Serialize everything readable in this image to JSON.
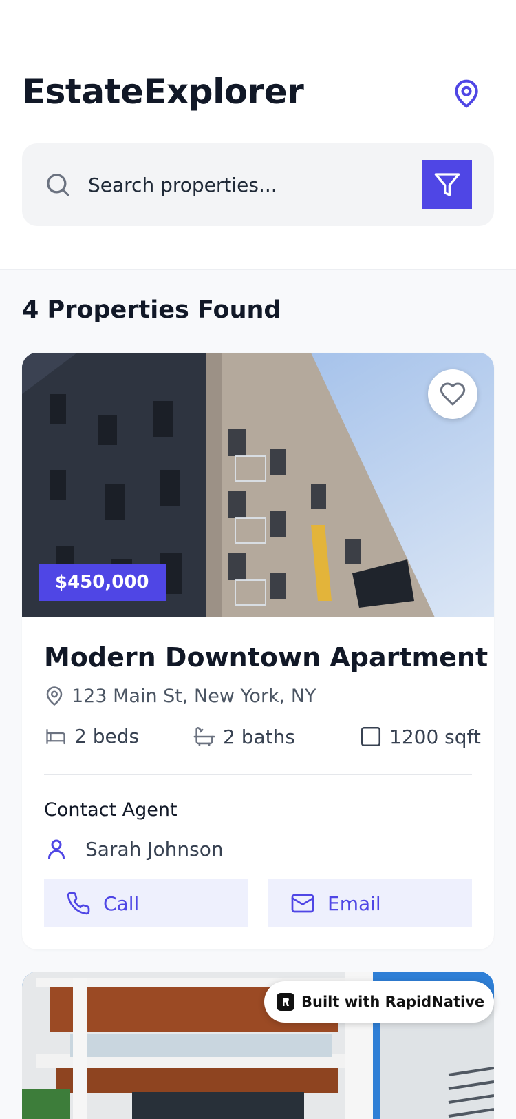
{
  "app": {
    "title": "EstateExplorer"
  },
  "search": {
    "placeholder": "Search properties..."
  },
  "results": {
    "count_text": "4 Properties Found"
  },
  "properties": [
    {
      "price": "$450,000",
      "title": "Modern Downtown Apartment",
      "address": "123 Main St, New York, NY",
      "beds": "2 beds",
      "baths": "2 baths",
      "sqft": "1200 sqft",
      "contact_label": "Contact Agent",
      "agent_name": "Sarah Johnson",
      "call_label": "Call",
      "email_label": "Email"
    }
  ],
  "badge": {
    "text": "Built with RapidNative"
  },
  "colors": {
    "accent": "#4f46e5",
    "accent_light": "#eef0fd",
    "text_primary": "#111827",
    "text_secondary": "#4b5563",
    "surface": "#f3f4f6"
  },
  "icons": {
    "header": "map-pin-icon",
    "search": "search-icon",
    "filter": "filter-icon",
    "favorite": "heart-icon",
    "address": "map-pin-icon",
    "beds": "bed-icon",
    "baths": "bath-icon",
    "sqft": "square-icon",
    "agent": "user-icon",
    "call": "phone-icon",
    "email": "mail-icon"
  }
}
